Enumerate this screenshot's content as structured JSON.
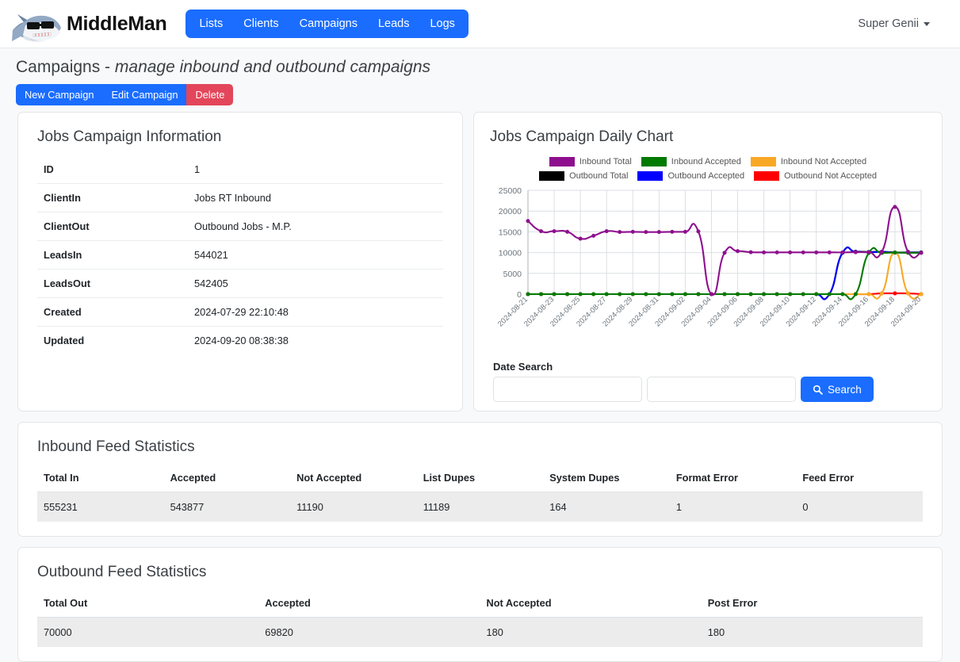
{
  "navbar": {
    "brand": "MiddleMan",
    "logo_icon": "shark-sunglasses-logo",
    "links": [
      {
        "label": "Lists"
      },
      {
        "label": "Clients"
      },
      {
        "label": "Campaigns"
      },
      {
        "label": "Leads"
      },
      {
        "label": "Logs"
      }
    ],
    "user": "Super Genii",
    "user_caret_icon": "caret-down-icon"
  },
  "page": {
    "title": "Campaigns - ",
    "subtitle": "manage inbound and outbound campaigns",
    "buttons": [
      {
        "label": "New Campaign",
        "style": "primary"
      },
      {
        "label": "Edit Campaign",
        "style": "primary"
      },
      {
        "label": "Delete",
        "style": "danger"
      }
    ]
  },
  "info_card": {
    "title": "Jobs Campaign Information",
    "rows": [
      {
        "key": "ID",
        "value": "1"
      },
      {
        "key": "ClientIn",
        "value": "Jobs RT Inbound"
      },
      {
        "key": "ClientOut",
        "value": "Outbound Jobs - M.P."
      },
      {
        "key": "LeadsIn",
        "value": "544021"
      },
      {
        "key": "LeadsOut",
        "value": "542405"
      },
      {
        "key": "Created",
        "value": "2024-07-29 22:10:48"
      },
      {
        "key": "Updated",
        "value": "2024-09-20 08:38:38"
      }
    ]
  },
  "chart_card": {
    "title": "Jobs Campaign Daily Chart",
    "date_search_label": "Date Search",
    "date_from_value": "",
    "date_to_value": "",
    "date_from_placeholder": "",
    "date_to_placeholder": "",
    "search_button_label": "Search",
    "search_icon": "magnifier-icon"
  },
  "chart_data": {
    "type": "line",
    "title": "Jobs Campaign Daily Chart",
    "xlabel": "",
    "ylabel": "",
    "ylim": [
      0,
      25000
    ],
    "yticks": [
      0,
      5000,
      10000,
      15000,
      20000,
      25000
    ],
    "grid": true,
    "legend_position": "top-center",
    "x": [
      "2024-08-21",
      "2024-08-22",
      "2024-08-23",
      "2024-08-24",
      "2024-08-25",
      "2024-08-26",
      "2024-08-27",
      "2024-08-28",
      "2024-08-29",
      "2024-08-30",
      "2024-08-31",
      "2024-09-01",
      "2024-09-02",
      "2024-09-03",
      "2024-09-04",
      "2024-09-05",
      "2024-09-06",
      "2024-09-07",
      "2024-09-08",
      "2024-09-09",
      "2024-09-10",
      "2024-09-11",
      "2024-09-12",
      "2024-09-13",
      "2024-09-14",
      "2024-09-15",
      "2024-09-16",
      "2024-09-17",
      "2024-09-18",
      "2024-09-19",
      "2024-09-20"
    ],
    "xtick_labels": [
      "2024-08-21",
      "2024-08-23",
      "2024-08-25",
      "2024-08-27",
      "2024-08-29",
      "2024-08-31",
      "2024-09-02",
      "2024-09-04",
      "2024-09-06",
      "2024-09-08",
      "2024-09-10",
      "2024-09-12",
      "2024-09-14",
      "2024-09-16",
      "2024-09-18",
      "2024-09-20"
    ],
    "series": [
      {
        "name": "Inbound Total",
        "color": "#8e0f8e",
        "values": [
          17600,
          15150,
          15150,
          15000,
          13350,
          14050,
          15150,
          14950,
          15000,
          14950,
          14950,
          15000,
          15000,
          15100,
          0,
          9950,
          10350,
          10100,
          10050,
          10050,
          10050,
          10050,
          10050,
          10050,
          10050,
          10100,
          10100,
          10200,
          21000,
          10200,
          9950
        ]
      },
      {
        "name": "Inbound Accepted",
        "color": "#007a00",
        "values": [
          0,
          0,
          0,
          0,
          0,
          0,
          0,
          0,
          0,
          0,
          0,
          0,
          0,
          0,
          0,
          0,
          0,
          0,
          0,
          0,
          0,
          0,
          0,
          0,
          0,
          0,
          9900,
          9900,
          10000,
          9950,
          9950
        ]
      },
      {
        "name": "Inbound Not Accepted",
        "color": "#f9a825",
        "values": [
          0,
          0,
          0,
          0,
          0,
          0,
          0,
          0,
          0,
          0,
          0,
          0,
          0,
          0,
          0,
          0,
          0,
          0,
          0,
          0,
          0,
          0,
          0,
          0,
          0,
          0,
          0,
          180,
          10000,
          180,
          0
        ]
      },
      {
        "name": "Outbound Total",
        "color": "#000000",
        "values": [
          0,
          0,
          0,
          0,
          0,
          0,
          0,
          0,
          0,
          0,
          0,
          0,
          0,
          0,
          0,
          0,
          0,
          0,
          0,
          0,
          0,
          0,
          0,
          0,
          9950,
          10200,
          10150,
          10200,
          10050,
          10050,
          10050
        ]
      },
      {
        "name": "Outbound Accepted",
        "color": "#0000ff",
        "values": [
          0,
          0,
          0,
          0,
          0,
          0,
          0,
          0,
          0,
          0,
          0,
          0,
          0,
          0,
          0,
          0,
          0,
          0,
          0,
          0,
          0,
          0,
          0,
          0,
          9950,
          10150,
          10100,
          10150,
          10000,
          10000,
          10000
        ]
      },
      {
        "name": "Outbound Not Accepted",
        "color": "#ff0000",
        "values": [
          0,
          0,
          0,
          0,
          0,
          0,
          0,
          0,
          0,
          0,
          0,
          0,
          0,
          0,
          0,
          0,
          0,
          0,
          0,
          0,
          0,
          0,
          0,
          0,
          0,
          0,
          0,
          180,
          180,
          180,
          0
        ]
      }
    ]
  },
  "inbound_stats": {
    "title": "Inbound Feed Statistics",
    "columns": [
      "Total In",
      "Accepted",
      "Not Accepted",
      "List Dupes",
      "System Dupes",
      "Format Error",
      "Feed Error"
    ],
    "rows": [
      [
        "555231",
        "543877",
        "11190",
        "11189",
        "164",
        "1",
        "0"
      ]
    ]
  },
  "outbound_stats": {
    "title": "Outbound Feed Statistics",
    "columns": [
      "Total Out",
      "Accepted",
      "Not Accepted",
      "Post Error"
    ],
    "rows": [
      [
        "70000",
        "69820",
        "180",
        "180"
      ]
    ]
  }
}
